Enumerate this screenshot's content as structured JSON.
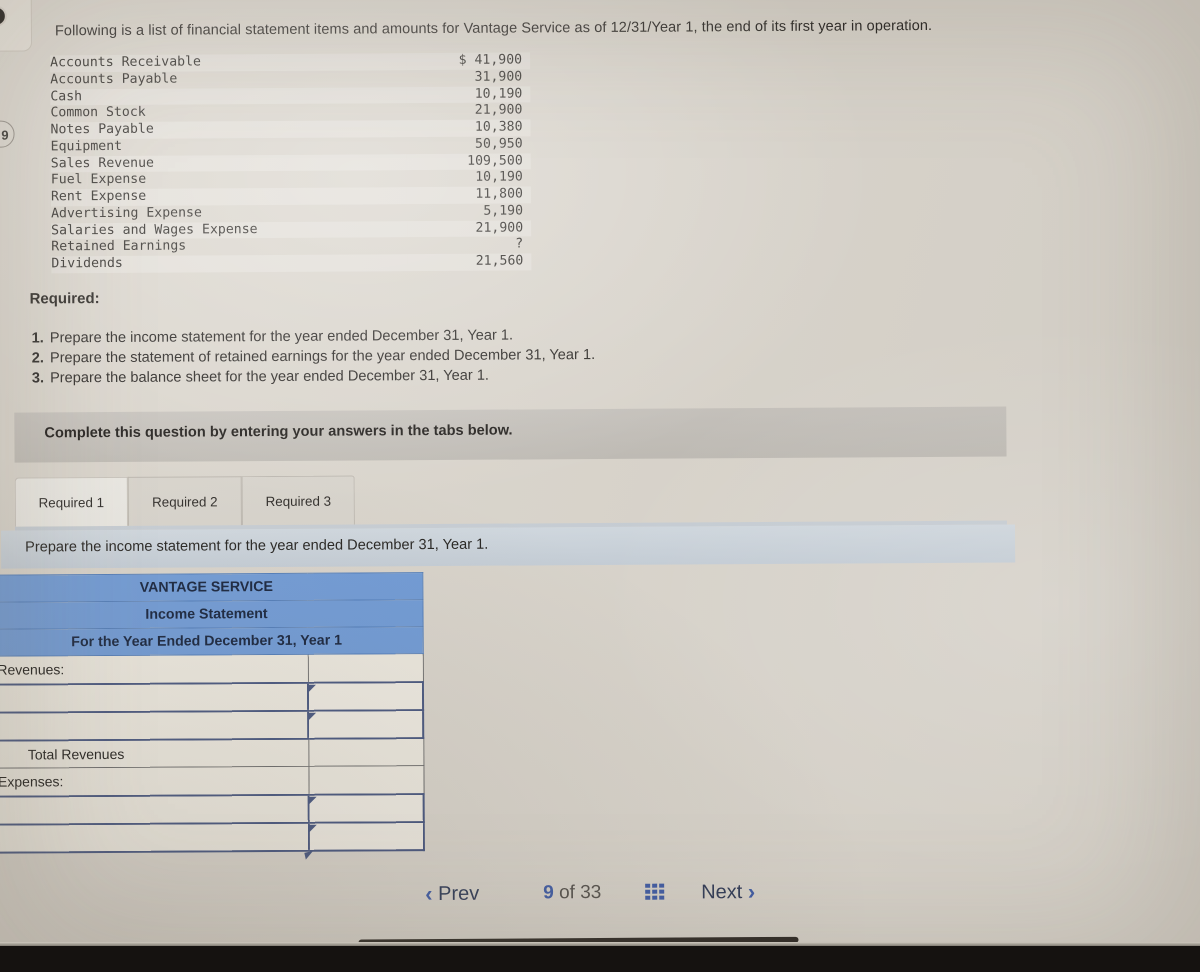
{
  "intro": "Following is a list of financial statement items and amounts for Vantage Service as of 12/31/Year 1, the end of its first year in operation.",
  "edge": {
    "badge_label": "9"
  },
  "items_table": {
    "rows": [
      {
        "label": "Accounts Receivable",
        "amount": "$ 41,900"
      },
      {
        "label": "Accounts Payable",
        "amount": "31,900"
      },
      {
        "label": "Cash",
        "amount": "10,190"
      },
      {
        "label": "Common Stock",
        "amount": "21,900"
      },
      {
        "label": "Notes Payable",
        "amount": "10,380"
      },
      {
        "label": "Equipment",
        "amount": "50,950"
      },
      {
        "label": "Sales Revenue",
        "amount": "109,500"
      },
      {
        "label": "Fuel Expense",
        "amount": "10,190"
      },
      {
        "label": "Rent Expense",
        "amount": "11,800"
      },
      {
        "label": "Advertising Expense",
        "amount": "5,190"
      },
      {
        "label": "Salaries and Wages Expense",
        "amount": "21,900"
      },
      {
        "label": "Retained Earnings",
        "amount": "?"
      },
      {
        "label": "Dividends",
        "amount": "21,560"
      }
    ]
  },
  "required": {
    "title": "Required:",
    "items": [
      {
        "num": "1.",
        "text": "Prepare the income statement for the year ended December 31, Year 1."
      },
      {
        "num": "2.",
        "text": "Prepare the statement of retained earnings for the year ended December 31, Year 1."
      },
      {
        "num": "3.",
        "text": "Prepare the balance sheet for the year ended December 31, Year 1."
      }
    ]
  },
  "complete_bar": {
    "text": "Complete this question by entering your answers in the tabs below."
  },
  "tabs": [
    {
      "label": "Required 1",
      "active": true
    },
    {
      "label": "Required 2",
      "active": false
    },
    {
      "label": "Required 3",
      "active": false
    }
  ],
  "prompt": {
    "text": "Prepare the income statement for the year ended December 31, Year 1."
  },
  "worksheet": {
    "header_lines": [
      "VANTAGE SERVICE",
      "Income Statement",
      "For the Year Ended December 31, Year 1"
    ],
    "rows": [
      {
        "label": "Revenues:",
        "value": "",
        "type": "section"
      },
      {
        "label": "",
        "value": "",
        "type": "input"
      },
      {
        "label": "",
        "value": "",
        "type": "input"
      },
      {
        "label": "Total Revenues",
        "value": "",
        "type": "total"
      },
      {
        "label": "Expenses:",
        "value": "",
        "type": "section"
      },
      {
        "label": "",
        "value": "",
        "type": "input"
      },
      {
        "label": "",
        "value": "",
        "type": "input-partial"
      }
    ]
  },
  "nav": {
    "prev_label": "Prev",
    "next_label": "Next",
    "prev_chevron": "‹",
    "next_chevron": "›",
    "current_page": "9",
    "of_label": "of",
    "total_pages": "33"
  },
  "colors": {
    "header_blue": "#6f9bd8",
    "accent_navy": "#46557f",
    "nav_blue": "#3f5ca8",
    "gray_bar": "#c3bfb9",
    "prompt_strip": "#cdd6de",
    "paper": "#dbd6cd"
  }
}
